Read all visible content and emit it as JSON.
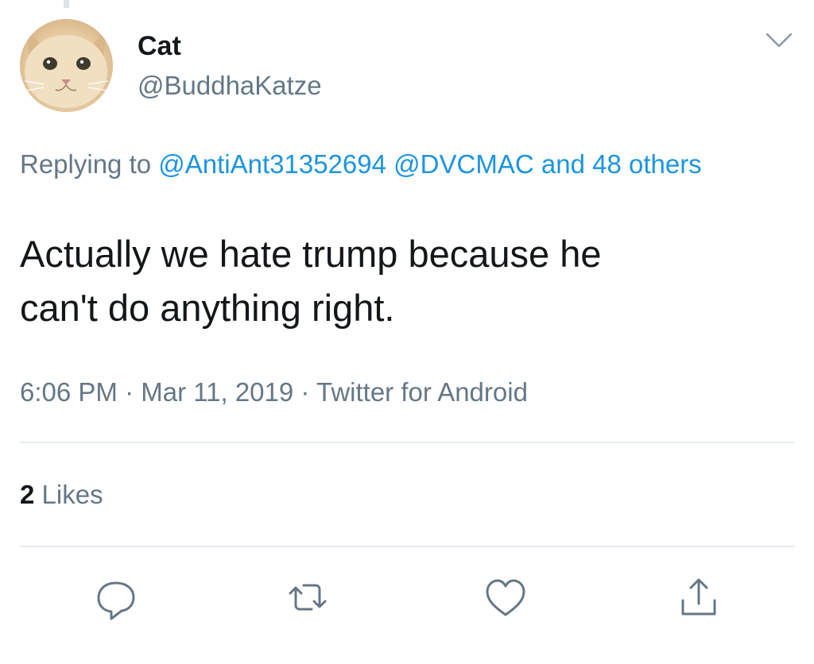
{
  "tweet": {
    "author": {
      "display_name": "Cat",
      "handle": "@BuddhaKatze"
    },
    "replying_prefix": "Replying to ",
    "replying_mentions": [
      "@AntiAnt31352694",
      "@DVCMAC"
    ],
    "replying_others": "and 48 others",
    "text_line_1": "Actually we hate trump because he",
    "text_line_2": "can't do anything right.",
    "time": "6:06 PM",
    "separator": " · ",
    "date": "Mar 11, 2019",
    "source": "Twitter for Android",
    "likes_count": "2",
    "likes_label": "Likes"
  },
  "icons": {
    "menu": "chevron-down-icon",
    "reply": "reply-icon",
    "retweet": "retweet-icon",
    "like": "heart-icon",
    "share": "share-icon"
  },
  "colors": {
    "link": "#1b95e0",
    "secondary_text": "#657786",
    "primary_text": "#14171a",
    "divider": "#e6ecf0"
  }
}
